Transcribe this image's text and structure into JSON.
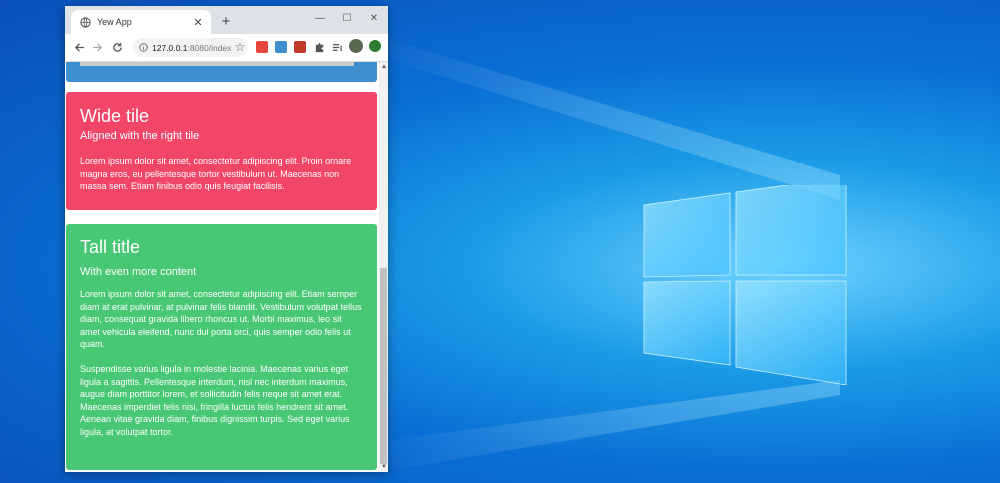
{
  "browser": {
    "tab_title": "Yew App",
    "new_tab": "+",
    "url_host": "127.0.0.1",
    "url_path": ":8080/index",
    "window_controls": {
      "minimize": "—",
      "maximize": "☐",
      "close": "✕"
    }
  },
  "tiles": {
    "wide": {
      "title": "Wide tile",
      "subtitle": "Aligned with the right tile",
      "body": "Lorem ipsum dolor sit amet, consectetur adipiscing elit. Proin ornare magna eros, eu pellentesque tortor vestibulum ut. Maecenas non massa sem. Etiam finibus odio quis feugiat facilisis."
    },
    "tall": {
      "title": "Tall title",
      "subtitle": "With even more content",
      "body1": "Lorem ipsum dolor sit amet, consectetur adipiscing elit. Etiam semper diam at erat pulvinar, at pulvinar felis blandit. Vestibulum volutpat tellus diam, consequat gravida libero rhoncus ut. Morbi maximus, leo sit amet vehicula eleifend, nunc dui porta orci, quis semper odio felis ut quam.",
      "body2": "Suspendisse varius ligula in molestie lacinia. Maecenas varius eget ligula a sagittis. Pellentesque interdum, nisl nec interdum maximus, augue diam porttitor lorem, et sollicitudin felis neque sit amet erat. Maecenas imperdiet felis nisi, fringilla luctus felis hendrerit sit amet. Aenean vitae gravida diam, finibus dignissim turpis. Sed eget varius ligula, at volutpat tortor."
    }
  },
  "colors": {
    "tile_blue": "#3e8ed0",
    "tile_red": "#f14668",
    "tile_green": "#48c774",
    "desktop": "#0a6fd4"
  }
}
